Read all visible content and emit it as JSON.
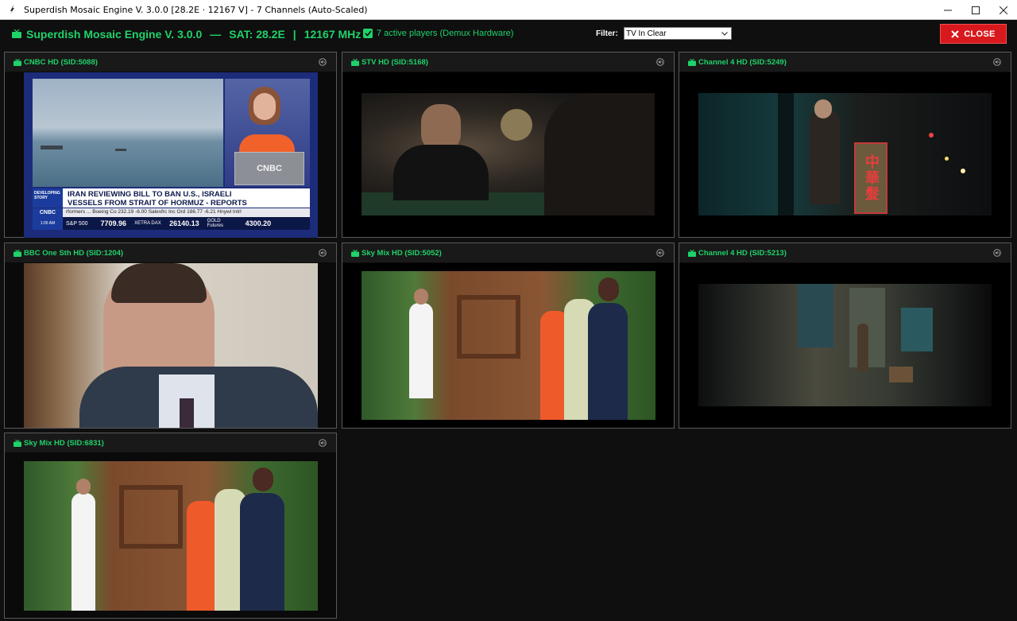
{
  "window": {
    "title": "Superdish Mosaic Engine V. 3.0.0 [28.2E · 12167 V] - 7 Channels (Auto-Scaled)",
    "controls": {
      "minimize": "—",
      "maximize": "☐",
      "close": "✕"
    }
  },
  "header": {
    "app_name": "Superdish Mosaic Engine V. 3.0.0",
    "separator1": "—",
    "sat": "SAT: 28.2E",
    "separator2": "|",
    "freq": "12167 MHz V",
    "active_players": "7 active players (Demux Hardware)",
    "active_checked": true,
    "filter_label": "Filter:",
    "filter_value": "TV In Clear",
    "close_label": "CLOSE"
  },
  "colors": {
    "accent_green": "#1fd26a",
    "close_red": "#d7191d",
    "background": "#0f0f0f"
  },
  "icons": {
    "channel": "tv-icon",
    "mute": "mute-icon",
    "filter_dropdown": "chevron-down-icon",
    "close": "close-icon"
  },
  "channels": [
    {
      "name": "CNBC HD (SID:5088)"
    },
    {
      "name": "STV HD (SID:5168)"
    },
    {
      "name": "Channel 4 HD (SID:5249)"
    },
    {
      "name": "BBC One Sth HD (SID:1204)"
    },
    {
      "name": "Sky Mix HD (SID:5052)"
    },
    {
      "name": "Channel 4 HD (SID:5213)"
    },
    {
      "name": "Sky Mix HD (SID:6831)"
    }
  ],
  "cnbc": {
    "tag1": "DEVELOPING STORY",
    "headline1": "IRAN REVIEWING BILL TO BAN U.S., ISRAELI",
    "headline2": "VESSELS FROM STRAIT OF HORMUZ - REPORTS",
    "logo": "CNBC",
    "ticker": "rformers ...  Boeing Co 232.19 -6.00  Salesfrc Inc Ord 186.77 -6.21  Hnywl Intrl",
    "time": "1:05 AM",
    "sp_label": "S&P 500",
    "sp_value": "7709.96",
    "dax_label": "XETRA DAX",
    "dax_value": "26140.13",
    "gold_label": "GOLD Futures",
    "gold_value": "4300.20"
  },
  "chinese_sign": "中華髮"
}
